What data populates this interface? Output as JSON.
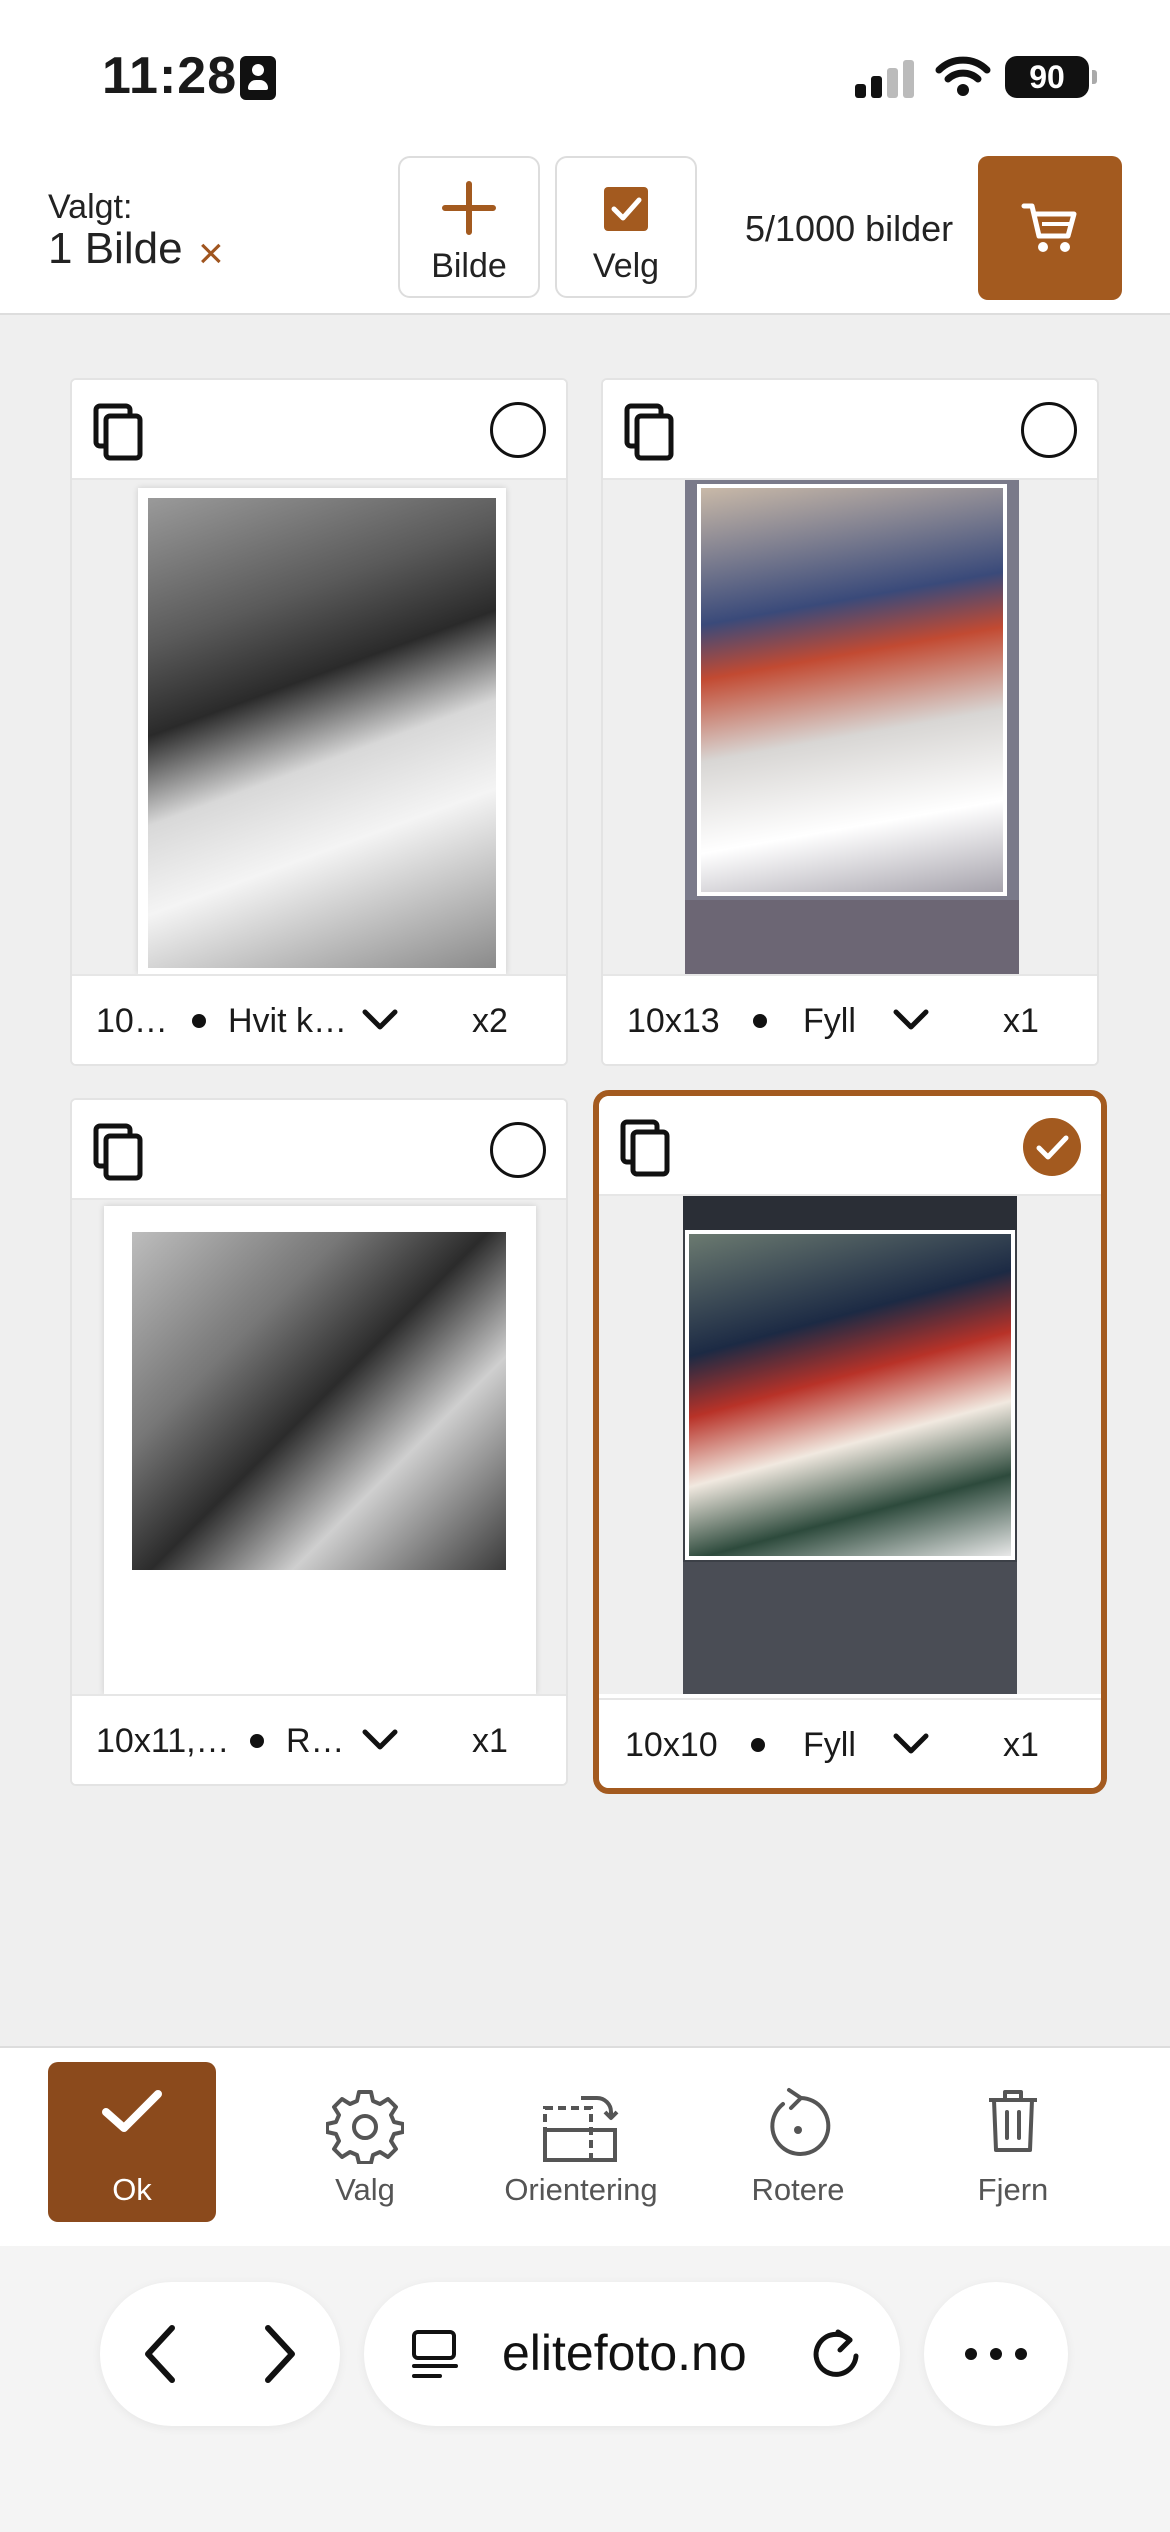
{
  "status_bar": {
    "time": "11:28",
    "battery": "90"
  },
  "header": {
    "selected_label": "Valgt:",
    "selected_value": "1 Bilde",
    "clear_symbol": "×",
    "add_image_label": "Bilde",
    "select_label": "Velg",
    "count_text": "5/1000 bilder"
  },
  "cards": [
    {
      "size": "10…",
      "fill": "Hvit k…",
      "quantity": "x2",
      "selected": false
    },
    {
      "size": "10x13",
      "fill": "Fyll",
      "quantity": "x1",
      "selected": false
    },
    {
      "size": "10x11,…",
      "fill": "R…",
      "quantity": "x1",
      "selected": false
    },
    {
      "size": "10x10",
      "fill": "Fyll",
      "quantity": "x1",
      "selected": true
    }
  ],
  "toolbar": {
    "ok": "Ok",
    "options": "Valg",
    "orientation": "Orientering",
    "rotate": "Rotere",
    "remove": "Fjern"
  },
  "browser": {
    "url": "elitefoto.no"
  },
  "colors": {
    "accent": "#a35a1f",
    "ok_button": "#8b4a1c"
  }
}
